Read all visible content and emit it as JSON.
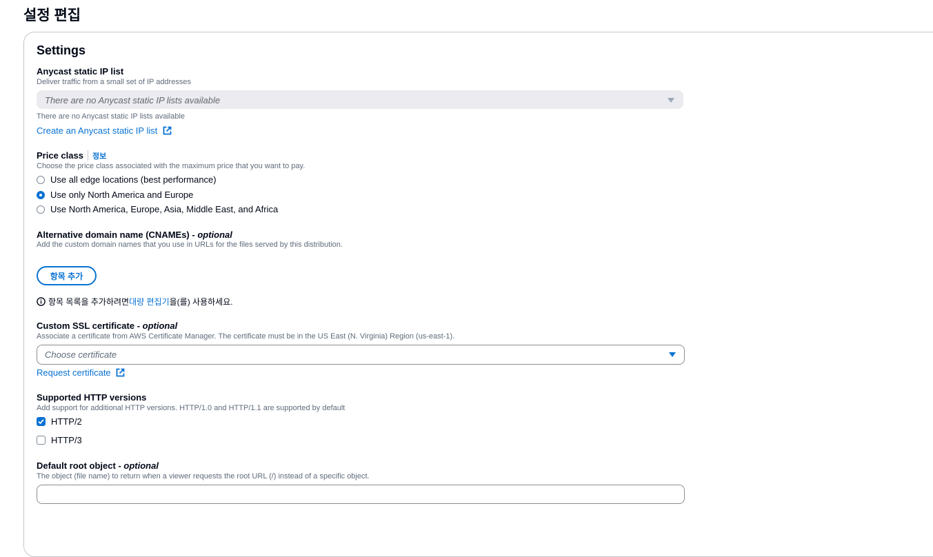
{
  "page": {
    "title": "설정 편집"
  },
  "settings": {
    "title": "Settings",
    "anycast": {
      "label": "Anycast static IP list",
      "description": "Deliver traffic from a small set of IP addresses",
      "select_value": "There are no Anycast static IP lists available",
      "helper": "There are no Anycast static IP lists available",
      "create_link": "Create an Anycast static IP list"
    },
    "price_class": {
      "label": "Price class",
      "info": "정보",
      "description": "Choose the price class associated with the maximum price that you want to pay.",
      "options": [
        {
          "label": "Use all edge locations (best performance)",
          "checked": false
        },
        {
          "label": "Use only North America and Europe",
          "checked": true
        },
        {
          "label": "Use North America, Europe, Asia, Middle East, and Africa",
          "checked": false
        }
      ]
    },
    "cnames": {
      "label": "Alternative domain name (CNAMEs)",
      "optional": "- optional",
      "description": "Add the custom domain names that you use in URLs for the files served by this distribution.",
      "add_button": "항목 추가",
      "note_prefix": "항목 목록을 추가하려면 ",
      "note_link": "대량 편집기",
      "note_suffix": "을(를) 사용하세요."
    },
    "ssl": {
      "label": "Custom SSL certificate",
      "optional": "- optional",
      "description": "Associate a certificate from AWS Certificate Manager. The certificate must be in the US East (N. Virginia) Region (us-east-1).",
      "placeholder": "Choose certificate",
      "request_link": "Request certificate"
    },
    "http": {
      "label": "Supported HTTP versions",
      "description": "Add support for additional HTTP versions. HTTP/1.0 and HTTP/1.1 are supported by default",
      "options": [
        {
          "label": "HTTP/2",
          "checked": true
        },
        {
          "label": "HTTP/3",
          "checked": false
        }
      ]
    },
    "root_object": {
      "label": "Default root object",
      "optional": "- optional",
      "description": "The object (file name) to return when a viewer requests the root URL (/) instead of a specific object.",
      "value": ""
    }
  },
  "colors": {
    "accent": "#0972d3",
    "text": "#000716",
    "muted": "#5f6b7a",
    "border": "#8c8c94"
  }
}
